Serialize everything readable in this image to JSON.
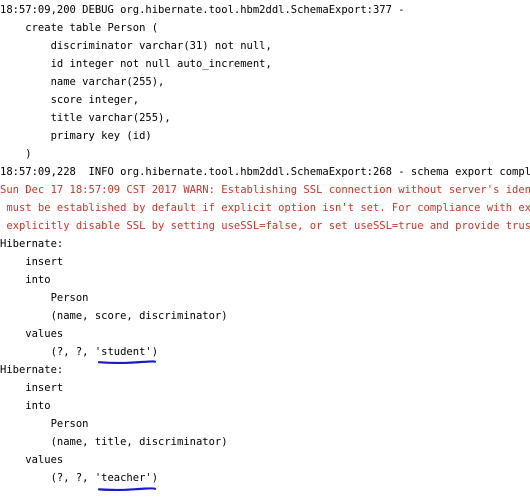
{
  "console": {
    "lines": [
      {
        "text": "18:57:09,200 DEBUG org.hibernate.tool.hbm2ddl.SchemaExport:377 -",
        "type": "normal"
      },
      {
        "text": "    create table Person (",
        "type": "normal"
      },
      {
        "text": "        discriminator varchar(31) not null,",
        "type": "normal"
      },
      {
        "text": "        id integer not null auto_increment,",
        "type": "normal"
      },
      {
        "text": "        name varchar(255),",
        "type": "normal"
      },
      {
        "text": "        score integer,",
        "type": "normal"
      },
      {
        "text": "        title varchar(255),",
        "type": "normal"
      },
      {
        "text": "        primary key (id)",
        "type": "normal"
      },
      {
        "text": "    )",
        "type": "normal"
      },
      {
        "text": "18:57:09,228  INFO org.hibernate.tool.hbm2ddl.SchemaExport:268 - schema export complete",
        "type": "normal"
      },
      {
        "text": "Sun Dec 17 18:57:09 CST 2017 WARN: Establishing SSL connection without server's identit",
        "type": "error"
      },
      {
        "text": " must be established by default if explicit option isn't set. For compliance with exist",
        "type": "error"
      },
      {
        "text": " explicitly disable SSL by setting useSSL=false, or set useSSL=true and provide truststo",
        "type": "error"
      },
      {
        "text": "Hibernate:",
        "type": "normal"
      },
      {
        "text": "    insert",
        "type": "normal"
      },
      {
        "text": "    into",
        "type": "normal"
      },
      {
        "text": "        Person",
        "type": "normal"
      },
      {
        "text": "        (name, score, discriminator)",
        "type": "normal"
      },
      {
        "text": "    values",
        "type": "normal"
      },
      {
        "text": "        (?, ?, 'student')",
        "type": "normal"
      },
      {
        "text": "Hibernate:",
        "type": "normal"
      },
      {
        "text": "    insert",
        "type": "normal"
      },
      {
        "text": "    into",
        "type": "normal"
      },
      {
        "text": "        Person",
        "type": "normal"
      },
      {
        "text": "        (name, title, discriminator)",
        "type": "normal"
      },
      {
        "text": "    values",
        "type": "normal"
      },
      {
        "text": "        (?, ?, 'teacher')",
        "type": "normal"
      }
    ]
  },
  "colors": {
    "text": "#000000",
    "error_text": "#c0392b",
    "annotation": "#1a1ac8",
    "background": "#ffffff"
  }
}
